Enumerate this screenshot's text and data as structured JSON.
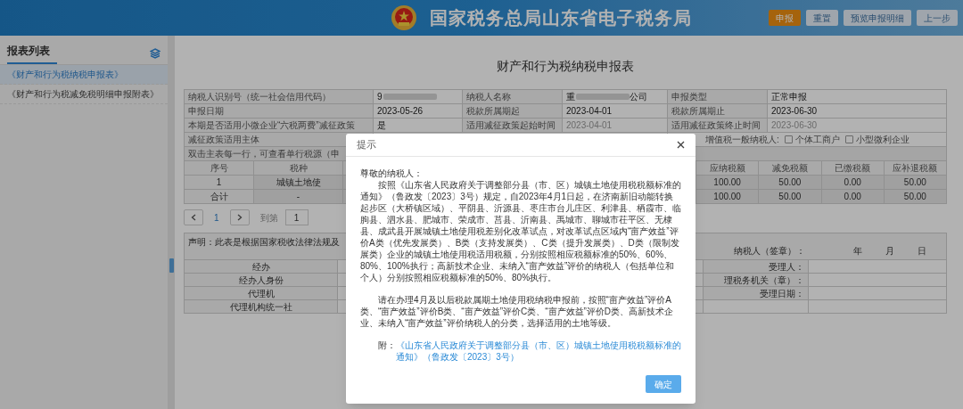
{
  "header": {
    "title": "国家税务总局山东省电子税务局",
    "buttons": [
      {
        "label": "申报",
        "kind": "primary"
      },
      {
        "label": "重置",
        "kind": "secondary"
      },
      {
        "label": "预览申报明细",
        "kind": "secondary"
      },
      {
        "label": "上一步",
        "kind": "secondary"
      }
    ]
  },
  "sidebar": {
    "title": "报表列表",
    "items": [
      {
        "label": "《财产和行为税纳税申报表》",
        "selected": true
      },
      {
        "label": "《财产和行为税减免税明细申报附表》",
        "selected": false
      }
    ]
  },
  "form": {
    "title": "财产和行为税纳税申报表",
    "info_rows": [
      [
        {
          "kind": "label",
          "text": "纳税人识别号（统一社会信用代码）"
        },
        {
          "kind": "redacted",
          "text": "9"
        },
        {
          "kind": "label",
          "text": "纳税人名称"
        },
        {
          "kind": "redacted",
          "text": "重",
          "text_after": "公司"
        },
        {
          "kind": "label",
          "text": "申报类型"
        },
        {
          "kind": "value",
          "text": "正常申报"
        }
      ],
      [
        {
          "kind": "label",
          "text": "申报日期"
        },
        {
          "kind": "value",
          "text": "2023-05-26"
        },
        {
          "kind": "label",
          "text": "税款所属期起"
        },
        {
          "kind": "value",
          "text": "2023-04-01"
        },
        {
          "kind": "label",
          "text": "税款所属期止"
        },
        {
          "kind": "value",
          "text": "2023-06-30"
        }
      ],
      [
        {
          "kind": "label",
          "text": "本期是否适用小微企业“六税两费”减征政策"
        },
        {
          "kind": "value",
          "text": "是"
        },
        {
          "kind": "label",
          "text": "适用减征政策起始时间"
        },
        {
          "kind": "readonly",
          "text": "2023-04-01"
        },
        {
          "kind": "label",
          "text": "适用减征政策终止时间"
        },
        {
          "kind": "readonly",
          "text": "2023-06-30"
        }
      ]
    ],
    "policy_subject_label": "减征政策适用主体",
    "vat_label": "增值税一般纳税人:",
    "vat_options": [
      {
        "label": "个体工商户",
        "checked": false
      },
      {
        "label": "小型微利企业",
        "checked": false
      }
    ],
    "note": "双击主表每一行，可查看单行税源（申",
    "tax_table": {
      "columns": [
        "序号",
        "税种",
        "应纳税额",
        "减免税额",
        "已缴税额",
        "应补退税额"
      ],
      "rows": [
        [
          "1",
          "城镇土地使",
          "100.00",
          "50.00",
          "0.00",
          "50.00"
        ],
        [
          "合计",
          "-",
          "100.00",
          "50.00",
          "0.00",
          "50.00"
        ]
      ]
    },
    "pager": {
      "page": "1",
      "goto_label": "到第",
      "goto_value": "1"
    },
    "declaration": {
      "statement": "声明：此表是根据国家税收法律法规及",
      "signature_label": "纳税人（签章）：",
      "date_parts": [
        "年",
        "月",
        "日"
      ]
    },
    "sign_rows": [
      {
        "left": "经办",
        "right": "受理人："
      },
      {
        "left": "经办人身份",
        "right": "理税务机关（章）："
      },
      {
        "left": "代理机",
        "right": "受理日期："
      },
      {
        "left": "代理机构统一社"
      }
    ]
  },
  "dialog": {
    "title": "提示",
    "greeting": "尊敬的纳税人：",
    "paragraphs": [
      "按照《山东省人民政府关于调整部分县（市、区）城镇土地使用税税额标准的通知》（鲁政发〔2023〕3号）规定，自2023年4月1日起，在济南新旧动能转换起步区（大桥镇区域）、平阴县、沂源县、枣庄市台儿庄区、利津县、栖霞市、临朐县、泗水县、肥城市、荣成市、莒县、沂南县、禹城市、聊城市茌平区、无棣县、成武县开展城镇土地使用税差别化改革试点，对改革试点区域内“亩产效益”评价A类（优先发展类）、B类（支持发展类）、C类（提升发展类）、D类（限制发展类）企业的城镇土地使用税适用税额，分别按照相应税额标准的50%、60%、80%、100%执行；高新技术企业、未纳入“亩产效益”评价的纳税人（包括单位和个人）分别按照相应税额标准的50%、80%执行。",
      "请在办理4月及以后税款属期土地使用税纳税申报前，按照“亩产效益”评价A类、“亩产效益”评价B类、“亩产效益”评价C类、“亩产效益”评价D类、高新技术企业、未纳入“亩产效益”评价纳税人的分类，选择适用的土地等级。"
    ],
    "attachment_label": "附：",
    "attachment_link": "《山东省人民政府关于调整部分县（市、区）城镇土地使用税税额标准的通知》（鲁政发〔2023〕3号）",
    "confirm": "确定"
  }
}
